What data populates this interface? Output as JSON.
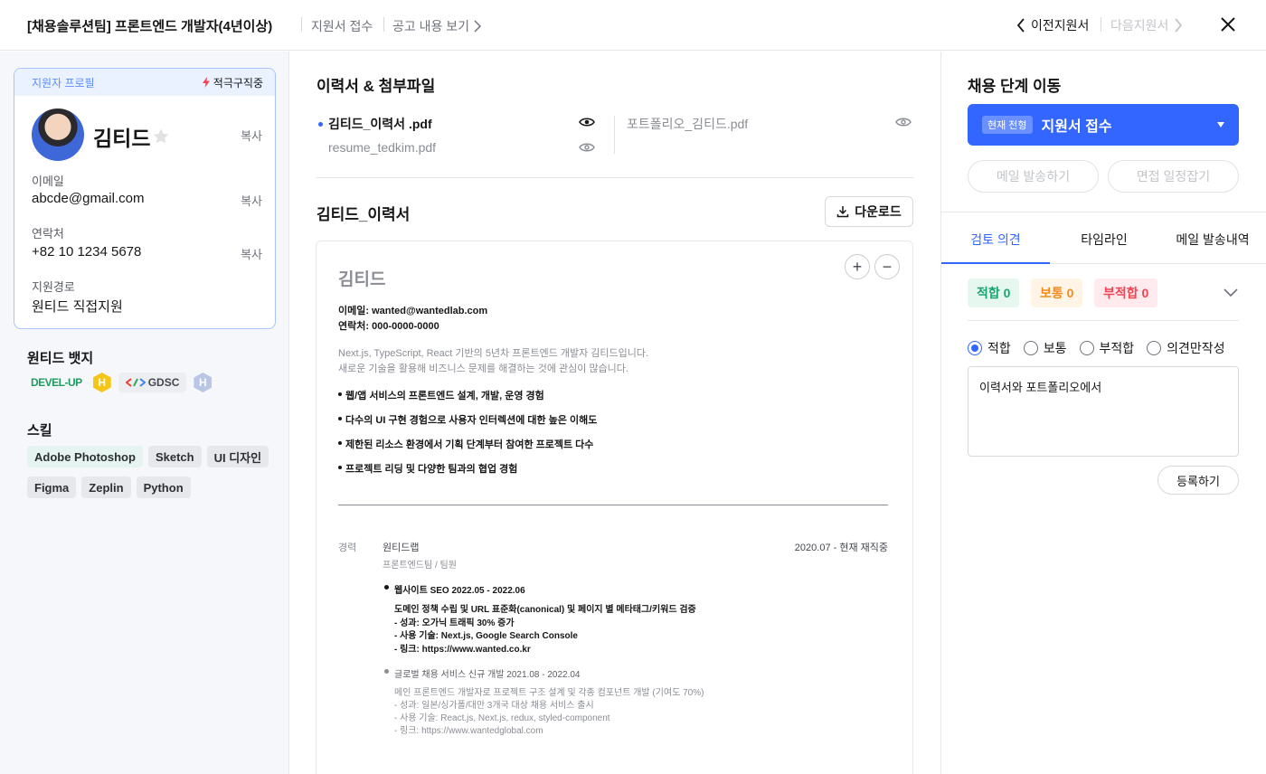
{
  "header": {
    "title": "[채용솔루션팀] 프론트엔드 개발자(4년이상)",
    "status": "지원서 접수",
    "view_posting": "공고 내용 보기",
    "prev": "이전지원서",
    "next": "다음지원서"
  },
  "profile": {
    "card_label": "지원자 프로필",
    "job_status": "적극구직중",
    "name": "김티드",
    "copy": "복사",
    "email_label": "이메일",
    "email": "abcde@gmail.com",
    "phone_label": "연락처",
    "phone": "+82 10 1234 5678",
    "source_label": "지원경로",
    "source": "원티드 직접지원"
  },
  "badges": {
    "title": "원티드 뱃지",
    "items": [
      "DEVEL-UP",
      "H",
      "GDSC",
      "H"
    ]
  },
  "skills": {
    "title": "스킬",
    "items": [
      "Adobe Photoshop",
      "Sketch",
      "UI 디자인",
      "Figma",
      "Zeplin",
      "Python"
    ]
  },
  "files": {
    "title": "이력서 & 첨부파일",
    "items": [
      "김티드_이력서 .pdf",
      "resume_tedkim.pdf",
      "포트폴리오_김티드.pdf"
    ]
  },
  "document": {
    "title": "김티드_이력서",
    "download": "다운로드",
    "resume": {
      "name": "김티드",
      "email": "이메일: wanted@wantedlab.com",
      "phone": "연락처: 000-0000-0000",
      "intro1": "Next.js, TypeScript, React 기반의 5년차 프론트엔드 개발자 김티드입니다.",
      "intro2": "새로운 기술을 활용해 비즈니스 문제를 해결하는 것에 관심이 많습니다.",
      "bullets": [
        "웹/앱 서비스의 프론트엔드 설계, 개발, 운영 경험",
        "다수의 UI 구현 경험으로 사용자 인터렉션에 대한 높은 이해도",
        "제한된 리소스 환경에서 기획 단계부터 참여한 프로젝트 다수",
        "프로젝트 리딩 및 다양한 팀과의 협업 경험"
      ],
      "career_label": "경력",
      "company": "원티드랩",
      "period": "2020.07 - 현재 재직중",
      "team": "프론트엔드팀 / 팀원",
      "project1_title": "웹사이트 SEO   2022.05 - 2022.06",
      "project1_lines": [
        "도메인 정책 수립 및 URL 표준화(canonical) 및 페이지 별 메타태그/키워드 검증",
        "- 성과: 오가닉 트래픽 30% 증가",
        "- 사용 기술: Next.js, Google Search Console",
        "- 링크: https://www.wanted.co.kr"
      ],
      "project2_title": "글로벌 채용 서비스 신규 개발   2021.08 - 2022.04",
      "project2_lines": [
        "메인 프론트엔드 개발자로 프로젝트 구조 설계 및 각종 컴포넌트 개발 (기여도 70%)",
        "- 성과: 일본/싱가폴/대만 3개국 대상 채용 서비스 출시",
        "- 사용 기술: React.js, Next.js, redux, styled-component",
        "- 링크: https://www.wantedglobal.com"
      ]
    }
  },
  "stage": {
    "title": "채용 단계 이동",
    "current_tag": "현재 전형",
    "current": "지원서 접수",
    "send_mail": "메일 발송하기",
    "schedule": "면접 일정잡기"
  },
  "review": {
    "tabs": [
      "검토 의견",
      "타임라인",
      "메일 발송내역"
    ],
    "fit": "적합 0",
    "normal": "보통 0",
    "unfit": "부적합 0",
    "options": [
      "적합",
      "보통",
      "부적합",
      "의견만작성"
    ],
    "comment": "이력서와 포트폴리오에서",
    "submit": "등록하기"
  },
  "colors": {
    "accent": "#3366ff",
    "fit": "#17a673",
    "normal": "#f08c1e",
    "unfit": "#f04452"
  }
}
